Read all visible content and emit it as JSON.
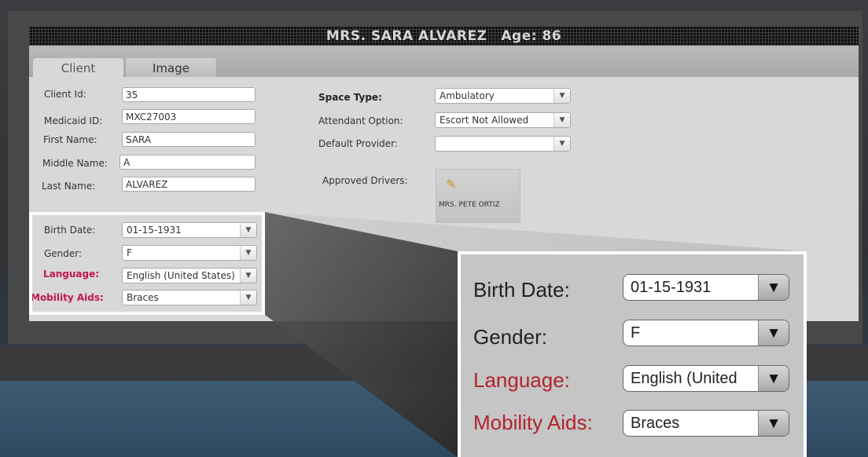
{
  "header": {
    "client_name": "MRS. SARA ALVAREZ",
    "age_label": "Age: 86"
  },
  "tabs": [
    {
      "label": "Client",
      "active": true
    },
    {
      "label": "Image",
      "active": false
    }
  ],
  "left_fields": {
    "client_id": {
      "label": "Client Id:",
      "value": "35"
    },
    "medicaid_id": {
      "label": "Medicaid ID:",
      "value": "MXC27003"
    },
    "first_name": {
      "label": "First Name:",
      "value": "SARA"
    },
    "middle_name": {
      "label": "Middle Name:",
      "value": "A"
    },
    "last_name": {
      "label": "Last Name:",
      "value": "ALVAREZ"
    }
  },
  "highlighted_fields": {
    "birth_date": {
      "label": "Birth Date:",
      "value": "01-15-1931"
    },
    "gender": {
      "label": "Gender:",
      "value": "F"
    },
    "language": {
      "label": "Language:",
      "value": "English (United States)"
    },
    "mobility_aids": {
      "label": "Mobility Aids:",
      "value": "Braces"
    }
  },
  "right_fields": {
    "space_type": {
      "label": "Space Type:",
      "value": "Ambulatory"
    },
    "attendant_option": {
      "label": "Attendant Option:",
      "value": "Escort Not Allowed"
    },
    "default_provider": {
      "label": "Default Provider:",
      "value": ""
    },
    "approved_drivers": {
      "label": "Approved Drivers:",
      "driver_name": "MRS. PETE ORTIZ",
      "icon": "pencil-icon"
    }
  },
  "zoom_callout": {
    "birth_date": {
      "label": "Birth Date:",
      "value": "01-15-1931"
    },
    "gender": {
      "label": "Gender:",
      "value": "F"
    },
    "language": {
      "label": "Language:",
      "value": "English (United"
    },
    "mobility_aids": {
      "label": "Mobility Aids:",
      "value": "Braces"
    }
  },
  "colors": {
    "required_label": "#c0174a",
    "zoom_required_label": "#b2232d",
    "panel": "#d8d8d8",
    "header_bar": "#111111"
  }
}
